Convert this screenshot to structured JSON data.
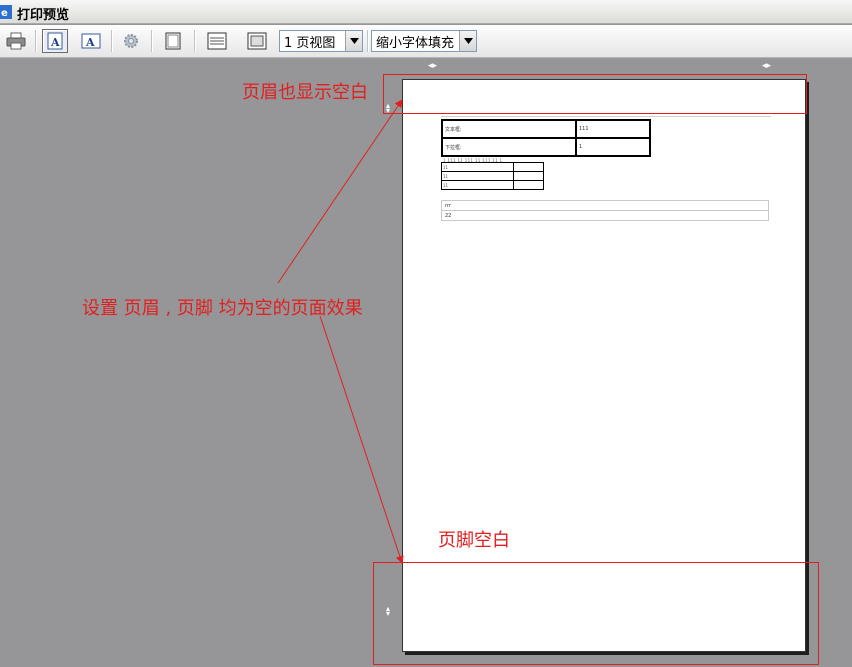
{
  "window": {
    "title": "打印预览"
  },
  "toolbar": {
    "view_select_value": "1 页视图",
    "fit_select_value": "缩小字体填充",
    "icons": [
      "printer-icon",
      "portrait-icon",
      "landscape-icon",
      "settings-gear-icon",
      "full-page-icon",
      "page-width-icon",
      "fit-page-icon"
    ]
  },
  "page": {
    "info_rows": [
      {
        "label": "文本框:",
        "value": "111"
      },
      {
        "label": "下拉框:",
        "value": "1"
      }
    ],
    "number_line": "1 111 11 111 11 111 11 1",
    "small_rows": [
      {
        "a": "11",
        "b": ""
      },
      {
        "a": "11",
        "b": ""
      },
      {
        "a": "11",
        "b": ""
      }
    ],
    "box_rows": [
      "rrr",
      "22"
    ]
  },
  "annotations": {
    "header_note": "页眉也显示空白",
    "main_note": "设置  页眉 , 页脚  均为空的页面效果",
    "footer_note": "页脚空白"
  },
  "colors": {
    "annotation": "#e02020",
    "background": "#969698"
  }
}
